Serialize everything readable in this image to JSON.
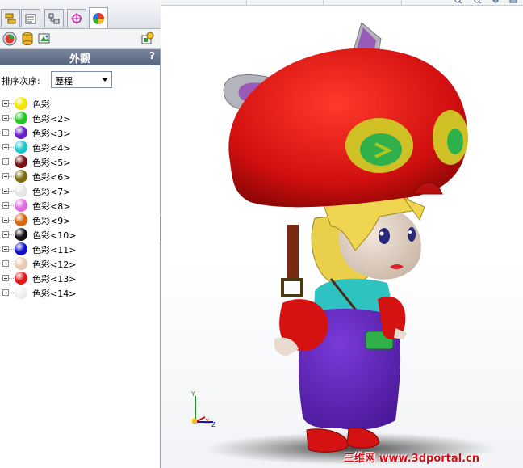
{
  "panel": {
    "tabs": [
      {
        "name": "feature-manager-tab",
        "icon": "feature-tree-icon"
      },
      {
        "name": "property-manager-tab",
        "icon": "property-icon"
      },
      {
        "name": "configuration-manager-tab",
        "icon": "configuration-icon"
      },
      {
        "name": "dimxpert-manager-tab",
        "icon": "crosshair-icon"
      },
      {
        "name": "appearance-manager-tab",
        "icon": "appearance-pie-icon",
        "active": true
      }
    ],
    "title": "外觀",
    "help": "?",
    "sort_label": "排序次序:",
    "sort_value": "歷程"
  },
  "appearances": [
    {
      "label": "色彩",
      "color": "#f2e600"
    },
    {
      "label": "色彩<2>",
      "color": "#22c41f"
    },
    {
      "label": "色彩<3>",
      "color": "#6a20c8"
    },
    {
      "label": "色彩<4>",
      "color": "#18c8cf"
    },
    {
      "label": "色彩<5>",
      "color": "#7a1212"
    },
    {
      "label": "色彩<6>",
      "color": "#7d6a10"
    },
    {
      "label": "色彩<7>",
      "color": "#e6e6e6"
    },
    {
      "label": "色彩<8>",
      "color": "#e26be0"
    },
    {
      "label": "色彩<9>",
      "color": "#d8670c"
    },
    {
      "label": "色彩<10>",
      "color": "#111111"
    },
    {
      "label": "色彩<11>",
      "color": "#1010c8"
    },
    {
      "label": "色彩<12>",
      "color": "#e9c9b0"
    },
    {
      "label": "色彩<13>",
      "color": "#e01818"
    },
    {
      "label": "色彩<14>",
      "color": "#efefef"
    }
  ],
  "watermark": "三维网 www.3dportal.cn",
  "triad": {
    "x": "X",
    "y": "Y",
    "z": "Z"
  }
}
